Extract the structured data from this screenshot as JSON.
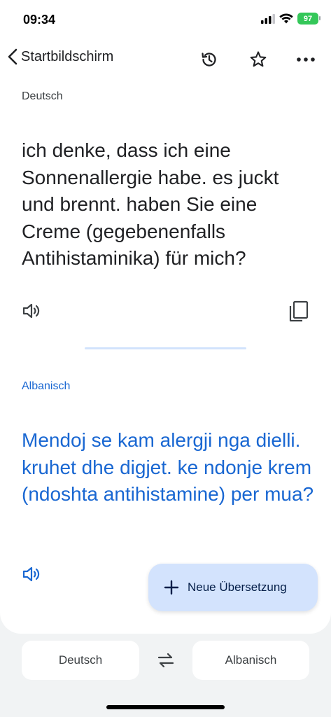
{
  "status_bar": {
    "time": "09:34",
    "battery": "97"
  },
  "nav": {
    "back_label": "Startbildschirm",
    "icons": [
      "back-chevron-icon",
      "history-icon",
      "star-icon",
      "more-icon"
    ]
  },
  "source": {
    "language": "Deutsch",
    "text": "ich denke, dass ich eine Sonnenallergie habe. es juckt und brennt. haben Sie eine Creme (gegebenenfalls Antihistaminika) für mich?"
  },
  "target": {
    "language": "Albanisch",
    "text": "Mendoj se kam alergji nga dielli. kruhet dhe digjet. ke ndonje krem (ndoshta antihistamine) per mua?"
  },
  "fab": {
    "label": "Neue Übersetzung",
    "icon": "plus-icon"
  },
  "language_bar": {
    "left": "Deutsch",
    "right": "Albanisch",
    "swap_icon": "swap-arrows-icon"
  },
  "colors": {
    "accent": "#1967d2",
    "fab_background": "#d3e3fd",
    "battery": "#34c759"
  }
}
